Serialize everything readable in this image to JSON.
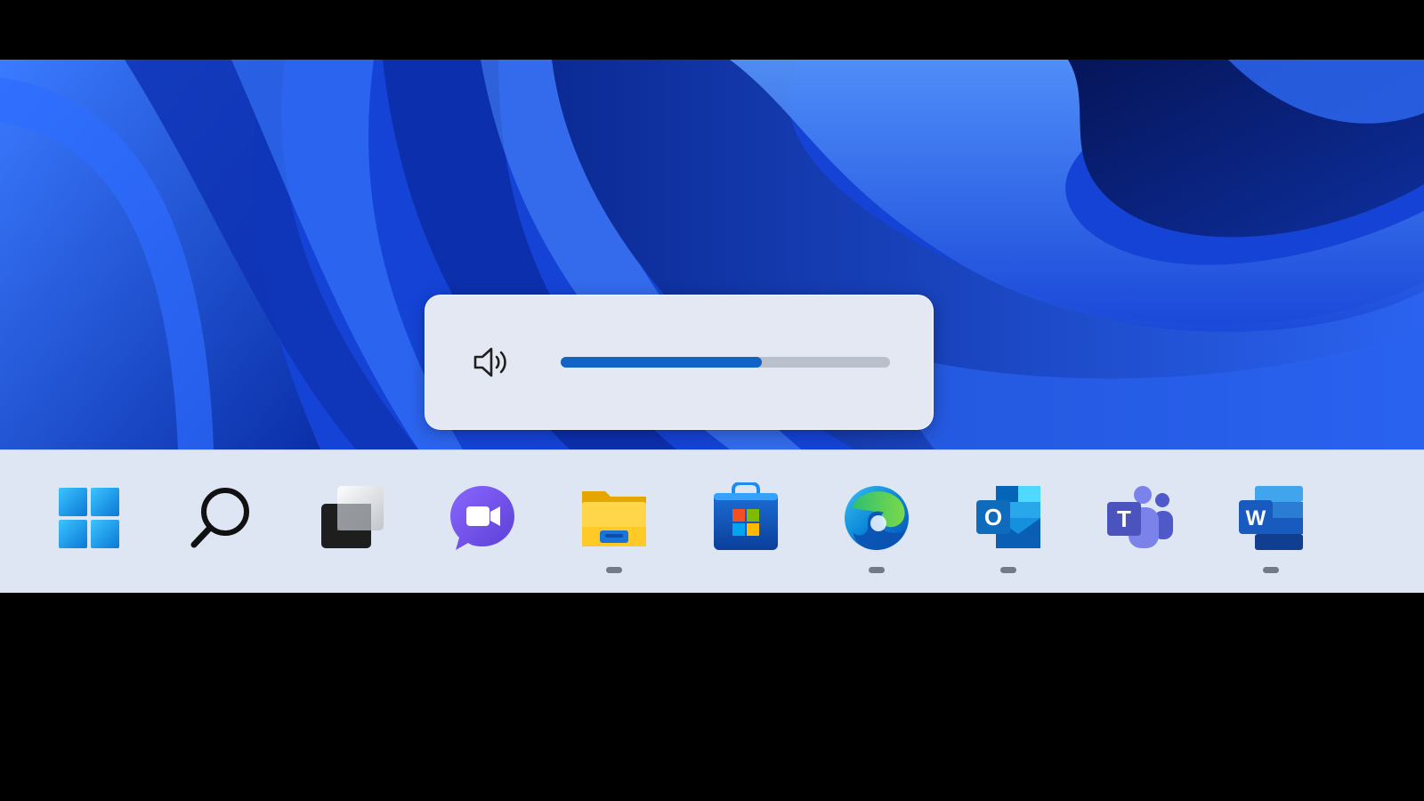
{
  "desktop": {
    "wallpaper": "windows-11-bloom-blue"
  },
  "volume_flyout": {
    "icon": "speaker-icon",
    "volume_fraction": 0.61,
    "accent_color": "#0f64c6"
  },
  "taskbar": {
    "items": [
      {
        "icon": "start-icon",
        "running": false
      },
      {
        "icon": "search-icon",
        "running": false
      },
      {
        "icon": "task-view-icon",
        "running": false
      },
      {
        "icon": "chat-icon",
        "running": false
      },
      {
        "icon": "file-explorer-icon",
        "running": true
      },
      {
        "icon": "microsoft-store-icon",
        "running": false
      },
      {
        "icon": "edge-icon",
        "running": true
      },
      {
        "icon": "outlook-icon",
        "running": true
      },
      {
        "icon": "teams-icon",
        "running": false
      },
      {
        "icon": "word-icon",
        "running": true
      }
    ]
  }
}
